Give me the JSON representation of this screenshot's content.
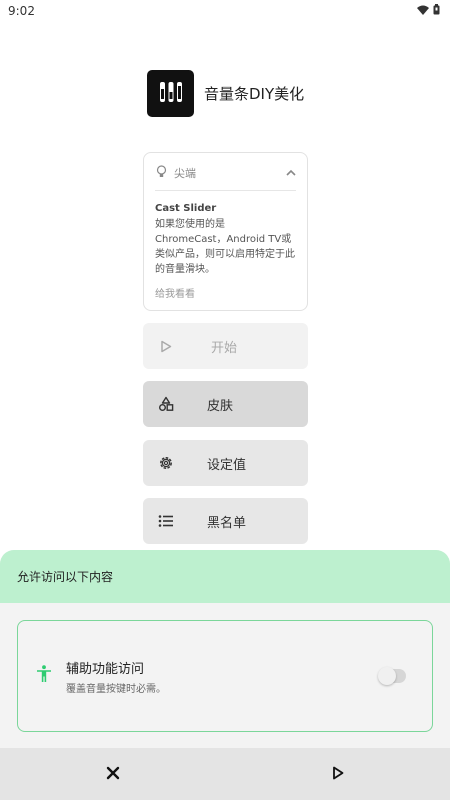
{
  "status_bar": {
    "time": "9:02",
    "icons": [
      "wifi-icon",
      "battery-icon"
    ]
  },
  "app": {
    "title": "音量条DIY美化",
    "logo_icon": "sliders-icon"
  },
  "tip_card": {
    "header_icon": "lightbulb-icon",
    "header_label": "尖端",
    "collapse_icon": "chevron-up-icon",
    "title": "Cast Slider",
    "body": "如果您使用的是ChromeCast，Android TV或类似产品，则可以启用特定于此的音量滑块。",
    "link": "给我看看"
  },
  "menu": {
    "start": {
      "label": "开始",
      "icon": "play-icon",
      "enabled": false
    },
    "skin": {
      "label": "皮肤",
      "icon": "shapes-icon"
    },
    "settings": {
      "label": "设定值",
      "icon": "gear-icon"
    },
    "blacklist": {
      "label": "黑名单",
      "icon": "list-icon"
    }
  },
  "permission_sheet": {
    "header": "允许访问以下内容",
    "item": {
      "icon": "accessibility-icon",
      "title": "辅助功能访问",
      "description": "覆盖音量按键时必需。",
      "enabled": false
    },
    "footer": {
      "close_icon": "close-icon",
      "next_icon": "play-icon"
    }
  },
  "colors": {
    "sheet_header": "#bdf0cf",
    "accent": "#2ecc71",
    "card_border": "#7bd69a"
  }
}
